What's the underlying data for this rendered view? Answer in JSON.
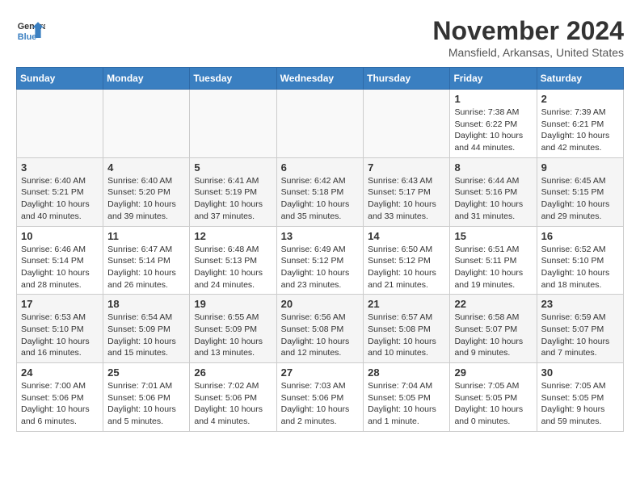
{
  "header": {
    "logo_line1": "General",
    "logo_line2": "Blue",
    "month": "November 2024",
    "location": "Mansfield, Arkansas, United States"
  },
  "weekdays": [
    "Sunday",
    "Monday",
    "Tuesday",
    "Wednesday",
    "Thursday",
    "Friday",
    "Saturday"
  ],
  "weeks": [
    [
      {
        "day": "",
        "info": ""
      },
      {
        "day": "",
        "info": ""
      },
      {
        "day": "",
        "info": ""
      },
      {
        "day": "",
        "info": ""
      },
      {
        "day": "",
        "info": ""
      },
      {
        "day": "1",
        "info": "Sunrise: 7:38 AM\nSunset: 6:22 PM\nDaylight: 10 hours\nand 44 minutes."
      },
      {
        "day": "2",
        "info": "Sunrise: 7:39 AM\nSunset: 6:21 PM\nDaylight: 10 hours\nand 42 minutes."
      }
    ],
    [
      {
        "day": "3",
        "info": "Sunrise: 6:40 AM\nSunset: 5:21 PM\nDaylight: 10 hours\nand 40 minutes."
      },
      {
        "day": "4",
        "info": "Sunrise: 6:40 AM\nSunset: 5:20 PM\nDaylight: 10 hours\nand 39 minutes."
      },
      {
        "day": "5",
        "info": "Sunrise: 6:41 AM\nSunset: 5:19 PM\nDaylight: 10 hours\nand 37 minutes."
      },
      {
        "day": "6",
        "info": "Sunrise: 6:42 AM\nSunset: 5:18 PM\nDaylight: 10 hours\nand 35 minutes."
      },
      {
        "day": "7",
        "info": "Sunrise: 6:43 AM\nSunset: 5:17 PM\nDaylight: 10 hours\nand 33 minutes."
      },
      {
        "day": "8",
        "info": "Sunrise: 6:44 AM\nSunset: 5:16 PM\nDaylight: 10 hours\nand 31 minutes."
      },
      {
        "day": "9",
        "info": "Sunrise: 6:45 AM\nSunset: 5:15 PM\nDaylight: 10 hours\nand 29 minutes."
      }
    ],
    [
      {
        "day": "10",
        "info": "Sunrise: 6:46 AM\nSunset: 5:14 PM\nDaylight: 10 hours\nand 28 minutes."
      },
      {
        "day": "11",
        "info": "Sunrise: 6:47 AM\nSunset: 5:14 PM\nDaylight: 10 hours\nand 26 minutes."
      },
      {
        "day": "12",
        "info": "Sunrise: 6:48 AM\nSunset: 5:13 PM\nDaylight: 10 hours\nand 24 minutes."
      },
      {
        "day": "13",
        "info": "Sunrise: 6:49 AM\nSunset: 5:12 PM\nDaylight: 10 hours\nand 23 minutes."
      },
      {
        "day": "14",
        "info": "Sunrise: 6:50 AM\nSunset: 5:12 PM\nDaylight: 10 hours\nand 21 minutes."
      },
      {
        "day": "15",
        "info": "Sunrise: 6:51 AM\nSunset: 5:11 PM\nDaylight: 10 hours\nand 19 minutes."
      },
      {
        "day": "16",
        "info": "Sunrise: 6:52 AM\nSunset: 5:10 PM\nDaylight: 10 hours\nand 18 minutes."
      }
    ],
    [
      {
        "day": "17",
        "info": "Sunrise: 6:53 AM\nSunset: 5:10 PM\nDaylight: 10 hours\nand 16 minutes."
      },
      {
        "day": "18",
        "info": "Sunrise: 6:54 AM\nSunset: 5:09 PM\nDaylight: 10 hours\nand 15 minutes."
      },
      {
        "day": "19",
        "info": "Sunrise: 6:55 AM\nSunset: 5:09 PM\nDaylight: 10 hours\nand 13 minutes."
      },
      {
        "day": "20",
        "info": "Sunrise: 6:56 AM\nSunset: 5:08 PM\nDaylight: 10 hours\nand 12 minutes."
      },
      {
        "day": "21",
        "info": "Sunrise: 6:57 AM\nSunset: 5:08 PM\nDaylight: 10 hours\nand 10 minutes."
      },
      {
        "day": "22",
        "info": "Sunrise: 6:58 AM\nSunset: 5:07 PM\nDaylight: 10 hours\nand 9 minutes."
      },
      {
        "day": "23",
        "info": "Sunrise: 6:59 AM\nSunset: 5:07 PM\nDaylight: 10 hours\nand 7 minutes."
      }
    ],
    [
      {
        "day": "24",
        "info": "Sunrise: 7:00 AM\nSunset: 5:06 PM\nDaylight: 10 hours\nand 6 minutes."
      },
      {
        "day": "25",
        "info": "Sunrise: 7:01 AM\nSunset: 5:06 PM\nDaylight: 10 hours\nand 5 minutes."
      },
      {
        "day": "26",
        "info": "Sunrise: 7:02 AM\nSunset: 5:06 PM\nDaylight: 10 hours\nand 4 minutes."
      },
      {
        "day": "27",
        "info": "Sunrise: 7:03 AM\nSunset: 5:06 PM\nDaylight: 10 hours\nand 2 minutes."
      },
      {
        "day": "28",
        "info": "Sunrise: 7:04 AM\nSunset: 5:05 PM\nDaylight: 10 hours\nand 1 minute."
      },
      {
        "day": "29",
        "info": "Sunrise: 7:05 AM\nSunset: 5:05 PM\nDaylight: 10 hours\nand 0 minutes."
      },
      {
        "day": "30",
        "info": "Sunrise: 7:05 AM\nSunset: 5:05 PM\nDaylight: 9 hours\nand 59 minutes."
      }
    ]
  ]
}
